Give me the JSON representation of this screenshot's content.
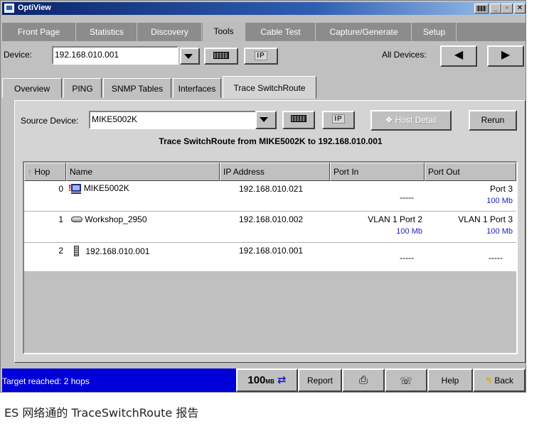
{
  "window": {
    "title": "OptiView",
    "icon": "app-icon",
    "controls": [
      "keyboard-icon",
      "minimize",
      "maximize",
      "close"
    ]
  },
  "menu": {
    "tabs": [
      "Front Page",
      "Statistics",
      "Discovery",
      "Tools",
      "Cable Test",
      "Capture/Generate",
      "Setup"
    ],
    "active": "Tools"
  },
  "device_bar": {
    "device_label": "Device:",
    "device_value": "192.168.010.001",
    "all_devices_label": "All Devices:"
  },
  "sub_tabs": {
    "tabs": [
      "Overview",
      "PING",
      "SNMP Tables",
      "Interfaces",
      "Trace SwitchRoute"
    ],
    "active": "Trace SwitchRoute"
  },
  "trace": {
    "source_label": "Source Device:",
    "source_value": "MIKE5002K",
    "host_detail_label": "Host Detail",
    "rerun_label": "Rerun",
    "heading": "Trace SwitchRoute from MIKE5002K to 192.168.010.001"
  },
  "table": {
    "columns": [
      "Hop",
      "Name",
      "IP Address",
      "Port In",
      "Port Out"
    ],
    "sort_indicator": "↑",
    "rows": [
      {
        "hop": "0",
        "icon": "warning-pc-icon",
        "name": "MIKE5002K",
        "ip": "192.168.010.021",
        "port_in": "-----",
        "port_in_speed": "",
        "port_out": "Port 3",
        "port_out_speed": "100 Mb"
      },
      {
        "hop": "1",
        "icon": "switch-icon",
        "name": "Workshop_2950",
        "ip": "192.168.010.002",
        "port_in": "VLAN 1 Port 2",
        "port_in_speed": "100 Mb",
        "port_out": "VLAN 1 Port 3",
        "port_out_speed": "100 Mb"
      },
      {
        "hop": "2",
        "icon": "server-icon",
        "name": "192.168.010.001",
        "ip": "192.168.010.001",
        "port_in": "-----",
        "port_in_speed": "",
        "port_out": "-----",
        "port_out_speed": ""
      }
    ]
  },
  "status_bar": {
    "message": "Target reached: 2 hops",
    "speed": "100",
    "speed_unit": "MB",
    "report_label": "Report",
    "help_label": "Help",
    "back_label": "Back"
  },
  "caption": "ES 网络通的 TraceSwitchRoute 报告",
  "colors": {
    "title_bar": "#0a246a",
    "status_bar": "#0000d8",
    "speed_text": "#1c1cc8",
    "menu_bg": "#8c8c8c"
  }
}
